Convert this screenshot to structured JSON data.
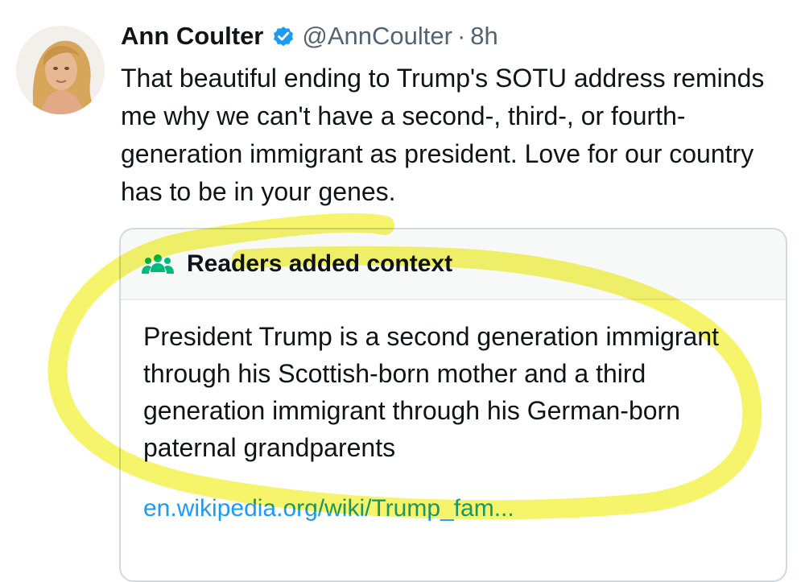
{
  "tweet": {
    "author_name": "Ann Coulter",
    "handle": "@AnnCoulter",
    "separator": "·",
    "timestamp": "8h",
    "verified_icon": "verified-badge-icon",
    "avatar_icon": "profile-photo",
    "text": "That beautiful ending to Trump's SOTU address reminds me why we can't have a second-, third-, or fourth- generation immigrant as president. Love for our country has to be in your genes."
  },
  "community_note": {
    "icon": "people-icon",
    "title": "Readers added context",
    "body": "President Trump is a second generation immigrant through his Scottish-born mother and a third generation immigrant through his German-born paternal grandparents",
    "link_text": "en.wikipedia.org/wiki/Trump_fam..."
  },
  "colors": {
    "text_primary": "#0f1419",
    "text_secondary": "#536471",
    "link": "#1d9bf0",
    "verified": "#1d9bf0",
    "note_icon": "#00ba7c",
    "highlighter": "#f5f35a"
  }
}
